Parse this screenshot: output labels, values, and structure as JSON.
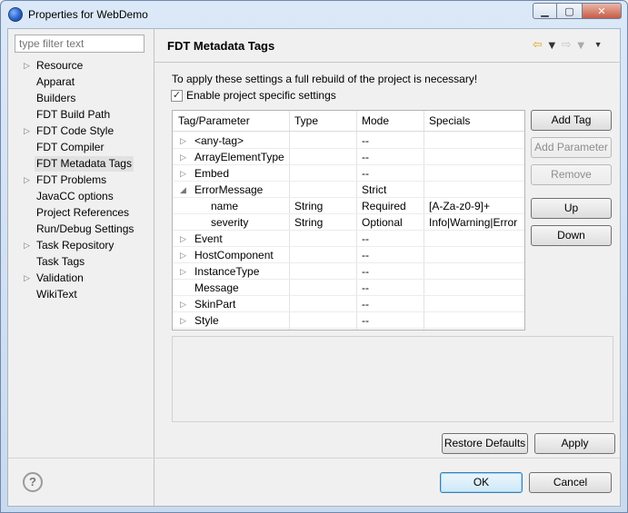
{
  "window": {
    "title": "Properties for WebDemo"
  },
  "filter": {
    "placeholder": "type filter text"
  },
  "nav": {
    "items": [
      {
        "label": "Resource",
        "expandable": true
      },
      {
        "label": "Apparat",
        "expandable": false
      },
      {
        "label": "Builders",
        "expandable": false
      },
      {
        "label": "FDT Build Path",
        "expandable": false
      },
      {
        "label": "FDT Code Style",
        "expandable": true
      },
      {
        "label": "FDT Compiler",
        "expandable": false
      },
      {
        "label": "FDT Metadata Tags",
        "expandable": false,
        "selected": true
      },
      {
        "label": "FDT Problems",
        "expandable": true
      },
      {
        "label": "JavaCC options",
        "expandable": false
      },
      {
        "label": "Project References",
        "expandable": false
      },
      {
        "label": "Run/Debug Settings",
        "expandable": false
      },
      {
        "label": "Task Repository",
        "expandable": true
      },
      {
        "label": "Task Tags",
        "expandable": false
      },
      {
        "label": "Validation",
        "expandable": true
      },
      {
        "label": "WikiText",
        "expandable": false
      }
    ]
  },
  "page": {
    "title": "FDT Metadata Tags",
    "info": "To apply these settings a full rebuild of the project is necessary!",
    "checkbox_label": "Enable project specific settings",
    "checkbox_checked": true
  },
  "table": {
    "columns": [
      "Tag/Parameter",
      "Type",
      "Mode",
      "Specials"
    ],
    "rows": [
      {
        "name": "<any-tag>",
        "type": "",
        "mode": "--",
        "specials": "",
        "level": 0,
        "arrow": "collapsed"
      },
      {
        "name": "ArrayElementType",
        "type": "",
        "mode": "--",
        "specials": "",
        "level": 0,
        "arrow": "collapsed"
      },
      {
        "name": "Embed",
        "type": "",
        "mode": "--",
        "specials": "",
        "level": 0,
        "arrow": "collapsed"
      },
      {
        "name": "ErrorMessage",
        "type": "",
        "mode": "Strict",
        "specials": "",
        "level": 0,
        "arrow": "expanded"
      },
      {
        "name": "name",
        "type": "String",
        "mode": "Required",
        "specials": "[A-Za-z0-9]+",
        "level": 1,
        "arrow": "none"
      },
      {
        "name": "severity",
        "type": "String",
        "mode": "Optional",
        "specials": "Info|Warning|Error",
        "level": 1,
        "arrow": "none"
      },
      {
        "name": "Event",
        "type": "",
        "mode": "--",
        "specials": "",
        "level": 0,
        "arrow": "collapsed"
      },
      {
        "name": "HostComponent",
        "type": "",
        "mode": "--",
        "specials": "",
        "level": 0,
        "arrow": "collapsed"
      },
      {
        "name": "InstanceType",
        "type": "",
        "mode": "--",
        "specials": "",
        "level": 0,
        "arrow": "collapsed"
      },
      {
        "name": "Message",
        "type": "",
        "mode": "--",
        "specials": "",
        "level": 0,
        "arrow": "none"
      },
      {
        "name": "SkinPart",
        "type": "",
        "mode": "--",
        "specials": "",
        "level": 0,
        "arrow": "collapsed"
      },
      {
        "name": "Style",
        "type": "",
        "mode": "--",
        "specials": "",
        "level": 0,
        "arrow": "collapsed"
      }
    ]
  },
  "buttons": {
    "add_tag": "Add Tag",
    "add_parameter": "Add Parameter",
    "remove": "Remove",
    "up": "Up",
    "down": "Down",
    "restore_defaults": "Restore Defaults",
    "apply": "Apply",
    "ok": "OK",
    "cancel": "Cancel"
  },
  "icons": {
    "help": "?",
    "back": "⇦",
    "forward": "⇨",
    "dropdown": "▼",
    "menu": "▼",
    "collapsed": "▷",
    "expanded": "◢"
  }
}
